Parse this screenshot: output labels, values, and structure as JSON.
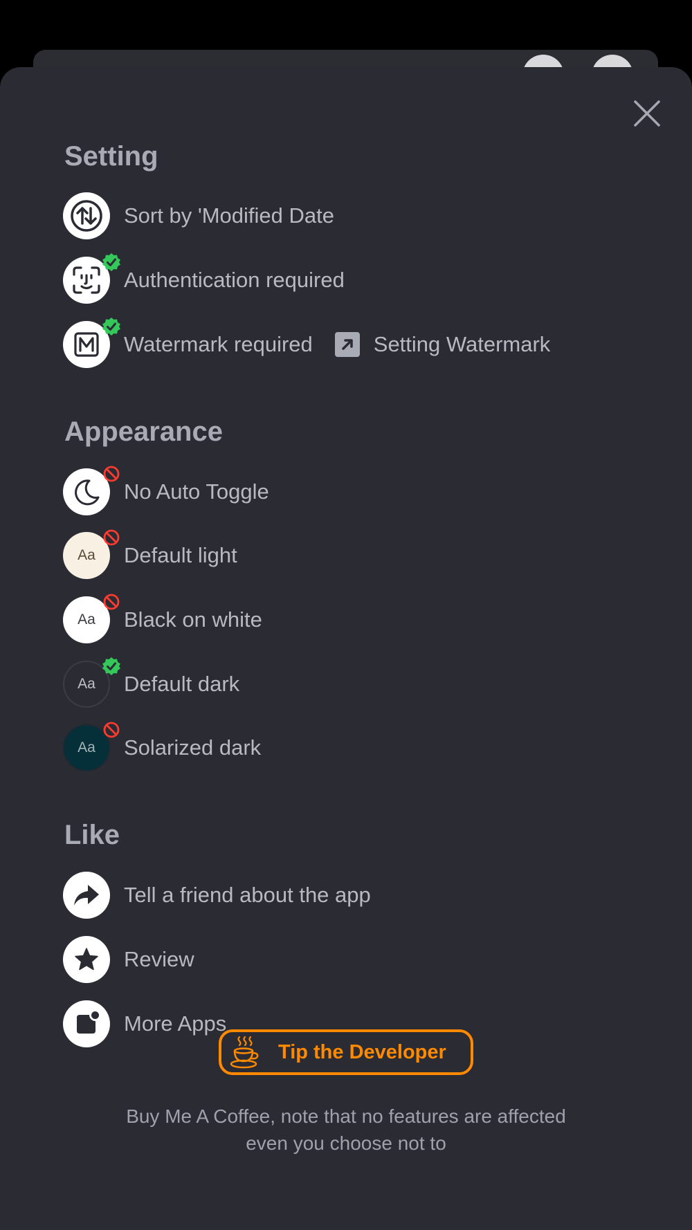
{
  "setting": {
    "title": "Setting",
    "sort_label": "Sort by 'Modified Date",
    "auth_label": "Authentication required",
    "watermark_label": "Watermark required",
    "watermark_link_label": "Setting Watermark"
  },
  "appearance": {
    "title": "Appearance",
    "auto_toggle_label": "No Auto Toggle",
    "themes": [
      {
        "label": "Default light",
        "sample": "Aa",
        "bg": "#f7f0e3",
        "fg": "#5a4a3a",
        "selected": false
      },
      {
        "label": "Black on white",
        "sample": "Aa",
        "bg": "#ffffff",
        "fg": "#3a3c43",
        "selected": false
      },
      {
        "label": "Default dark",
        "sample": "Aa",
        "bg": "#2a2b33",
        "fg": "#c0c2c9",
        "selected": true
      },
      {
        "label": "Solarized dark",
        "sample": "Aa",
        "bg": "#05303a",
        "fg": "#a6b5b8",
        "selected": false
      }
    ]
  },
  "like": {
    "title": "Like",
    "share_label": "Tell a friend about the app",
    "review_label": "Review",
    "more_apps_label": "More Apps"
  },
  "tip": {
    "button_label": "Tip the Developer",
    "note": "Buy Me A Coffee, note that no features are affected even you choose not to"
  },
  "colors": {
    "accent": "#ff8a00",
    "enabled_badge": "#34c759",
    "disabled_badge": "#ff3b30",
    "sheet_bg": "#2a2b33"
  }
}
